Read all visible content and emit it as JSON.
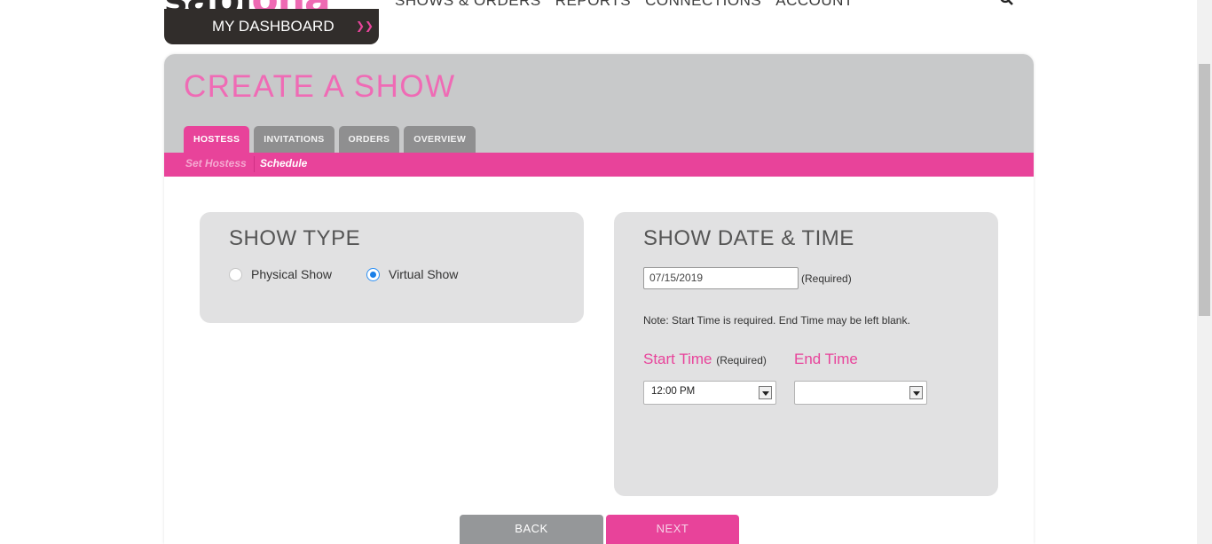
{
  "header": {
    "logo": {
      "part1": "sabi",
      "part2": "ona"
    },
    "dashboard_label": "MY DASHBOARD",
    "nav": [
      "SHOWS & ORDERS",
      "REPORTS",
      "CONNECTIONS",
      "ACCOUNT"
    ]
  },
  "page": {
    "title": "CREATE A SHOW",
    "tabs": [
      "HOSTESS",
      "INVITATIONS",
      "ORDERS",
      "OVERVIEW"
    ],
    "active_tab": "HOSTESS",
    "subnav": [
      "Set Hostess",
      "Schedule"
    ]
  },
  "show_type": {
    "title": "SHOW TYPE",
    "options": [
      {
        "label": "Physical Show",
        "selected": false
      },
      {
        "label": "Virtual Show",
        "selected": true
      }
    ]
  },
  "show_date": {
    "title": "SHOW DATE & TIME",
    "date_value": "07/15/2019",
    "required_note": "(Required)",
    "note": "Note: Start Time is required. End Time may be left blank.",
    "start_label": "Start Time",
    "start_required": "(Required)",
    "start_value": "12:00 PM",
    "end_label": "End Time",
    "end_value": ""
  },
  "buttons": {
    "back": "BACK",
    "next": "NEXT"
  },
  "colors": {
    "accent": "#e8439a",
    "title_pink": "#ef6bb5",
    "header_gray": "#c8c9ca",
    "card_gray": "#e1e1e2",
    "dark": "#312d2b"
  }
}
